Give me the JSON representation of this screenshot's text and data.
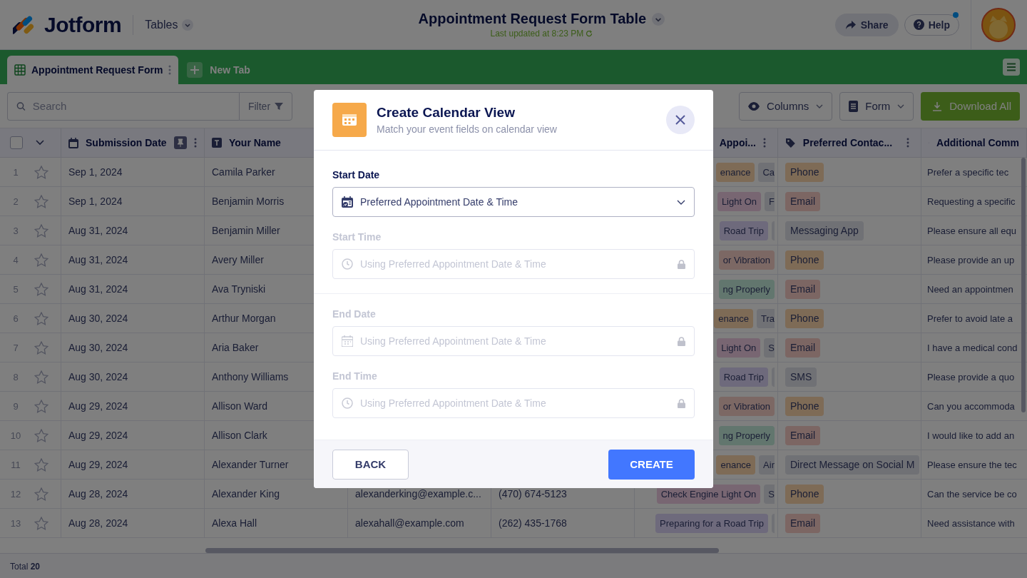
{
  "header": {
    "logo": "Jotform",
    "tables_menu": "Tables",
    "title": "Appointment Request Form Table",
    "last_updated": "Last updated at 8:23 PM",
    "share": "Share",
    "help": "Help",
    "help_notification": true
  },
  "tabs": [
    {
      "label": "Appointment Request Form",
      "selected": true
    }
  ],
  "new_tab": "New Tab",
  "toolbar": {
    "search": {
      "placeholder": "Search"
    },
    "filter": "Filter",
    "columns": "Columns",
    "form": "Form",
    "download": "Download All"
  },
  "table": {
    "select_all": {
      "checked": false
    },
    "columns": [
      {
        "kind": "date",
        "label": "Submission Date",
        "pinned": true
      },
      {
        "kind": "text",
        "label": "Your Name"
      },
      {
        "kind": "covered"
      },
      {
        "kind": "covered"
      },
      {
        "kind": "tags",
        "label": "Appoi..."
      },
      {
        "kind": "tag",
        "label": "Preferred Contac..."
      },
      {
        "kind": "longtext",
        "label": "Additional Comm"
      }
    ],
    "rows": [
      {
        "number": "1",
        "starred": false,
        "date": "Sep 1, 2024",
        "name": "Camila Parker",
        "appointment": [
          {
            "text": "enance",
            "color": "#7e6b56"
          },
          {
            "text": "Ca",
            "color": "#707175"
          }
        ],
        "contact": {
          "text": "Phone",
          "color": "#7e6b56"
        },
        "comment": "Prefer a specific tec"
      },
      {
        "number": "2",
        "starred": false,
        "date": "Sep 1, 2024",
        "name": "Benjamin Morris",
        "appointment": [
          {
            "text": "Light On",
            "color": "#786672"
          },
          {
            "text": "F",
            "color": "#707175"
          }
        ],
        "contact": {
          "text": "Email",
          "color": "#7c6663"
        },
        "comment": "Requesting a specific"
      },
      {
        "number": "3",
        "starred": false,
        "date": "Aug 31, 2024",
        "name": "Benjamin Miller",
        "appointment": [
          {
            "text": "Road Trip",
            "color": "#6e6a7c"
          },
          {
            "color": "#707175"
          }
        ],
        "contact": {
          "text": "Messaging App",
          "color": "#707175"
        },
        "comment": "Please ensure all equ"
      },
      {
        "number": "4",
        "starred": false,
        "date": "Aug 31, 2024",
        "name": "Avery Miller",
        "appointment": [
          {
            "text": "or Vibration",
            "color": "#7c6864"
          }
        ],
        "contact": {
          "text": "Phone",
          "color": "#7e6b56"
        },
        "comment": "Please provide an up"
      },
      {
        "number": "5",
        "starred": false,
        "date": "Aug 31, 2024",
        "name": "Ava Tryniski",
        "appointment": [
          {
            "text": "ng Properly",
            "color": "#62766e"
          }
        ],
        "contact": {
          "text": "Email",
          "color": "#7c6663"
        },
        "comment": "Need an appointmen"
      },
      {
        "number": "6",
        "starred": false,
        "date": "Aug 30, 2024",
        "name": "Arthur Morgan",
        "appointment": [
          {
            "text": "enance",
            "color": "#7e6b56"
          },
          {
            "text": "Tra",
            "color": "#707175"
          }
        ],
        "contact": {
          "text": "Phone",
          "color": "#7e6b56"
        },
        "comment": "Prefer to avoid late a"
      },
      {
        "number": "7",
        "starred": false,
        "date": "Aug 30, 2024",
        "name": "Aria Baker",
        "appointment": [
          {
            "text": "Light On",
            "color": "#786672"
          },
          {
            "text": "S",
            "color": "#707175"
          }
        ],
        "contact": {
          "text": "Email",
          "color": "#7c6663"
        },
        "comment": "I have a medical cond"
      },
      {
        "number": "8",
        "starred": false,
        "date": "Aug 30, 2024",
        "name": "Anthony Williams",
        "appointment": [
          {
            "text": "Road Trip",
            "color": "#6e6a7c"
          },
          {
            "color": "#707175"
          }
        ],
        "contact": {
          "text": "SMS",
          "color": "#707175"
        },
        "comment": "Please provide a quo"
      },
      {
        "number": "9",
        "starred": false,
        "date": "Aug 29, 2024",
        "name": "Allison Ward",
        "appointment": [
          {
            "text": "or Vibration",
            "color": "#7c6864"
          }
        ],
        "contact": {
          "text": "Phone",
          "color": "#7e6b56"
        },
        "comment": "Can you accommoda"
      },
      {
        "number": "10",
        "starred": false,
        "date": "Aug 29, 2024",
        "name": "Allison Clark",
        "appointment": [
          {
            "text": "ng Properly",
            "color": "#62766e"
          }
        ],
        "contact": {
          "text": "Email",
          "color": "#7c6663"
        },
        "comment": "I would like to add an"
      },
      {
        "number": "11",
        "starred": false,
        "date": "Aug 29, 2024",
        "name": "Alexander Turner",
        "appointment": [
          {
            "text": "enance",
            "color": "#7e6b56"
          },
          {
            "text": "Air",
            "color": "#707175"
          }
        ],
        "contact": {
          "text": "Direct Message on Social M",
          "color": "#707175"
        },
        "comment": "Please ensure the tec"
      },
      {
        "number": "12",
        "starred": false,
        "date": "Aug 28, 2024",
        "name": "Alexander King",
        "email": "alexanderking@example.c...",
        "phone": "(470) 674-5123",
        "appointment": [
          {
            "text": "Check Engine Light On",
            "color": "#786672"
          },
          {
            "text": "S",
            "color": "#707175"
          }
        ],
        "contact": {
          "text": "Phone",
          "color": "#7e6b56"
        },
        "comment": "Can the service be co"
      },
      {
        "number": "13",
        "starred": false,
        "date": "Aug 28, 2024",
        "name": "Alexa Hall",
        "email": "alexahall@example.com",
        "phone": "(262) 435-1768",
        "appointment": [
          {
            "text": "Preparing for a Road Trip",
            "color": "#6e6a7c"
          },
          {
            "color": "#707175"
          }
        ],
        "contact": {
          "text": "Email",
          "color": "#7c6663"
        },
        "comment": "Need assistance with"
      }
    ],
    "total": "Total **20**"
  },
  "modal": {
    "title": "Create Calendar View",
    "subtitle": "Match your event fields on calendar view",
    "sections": [
      {
        "fields": [
          {
            "label": "Start Date",
            "kind": "date",
            "value": "Preferred Appointment Date & Time",
            "locked": false
          },
          {
            "label": "Start Time",
            "kind": "time",
            "placeholder": "Using Preferred Appointment Date & Time",
            "locked": true
          }
        ]
      },
      {
        "fields": [
          {
            "label": "End Date",
            "kind": "date",
            "placeholder": "Using Preferred Appointment Date & Time",
            "locked": true
          },
          {
            "label": "End Time",
            "kind": "time",
            "placeholder": "Using Preferred Appointment Date & Time",
            "locked": true
          }
        ]
      }
    ],
    "back": "BACK",
    "create": "CREATE"
  }
}
